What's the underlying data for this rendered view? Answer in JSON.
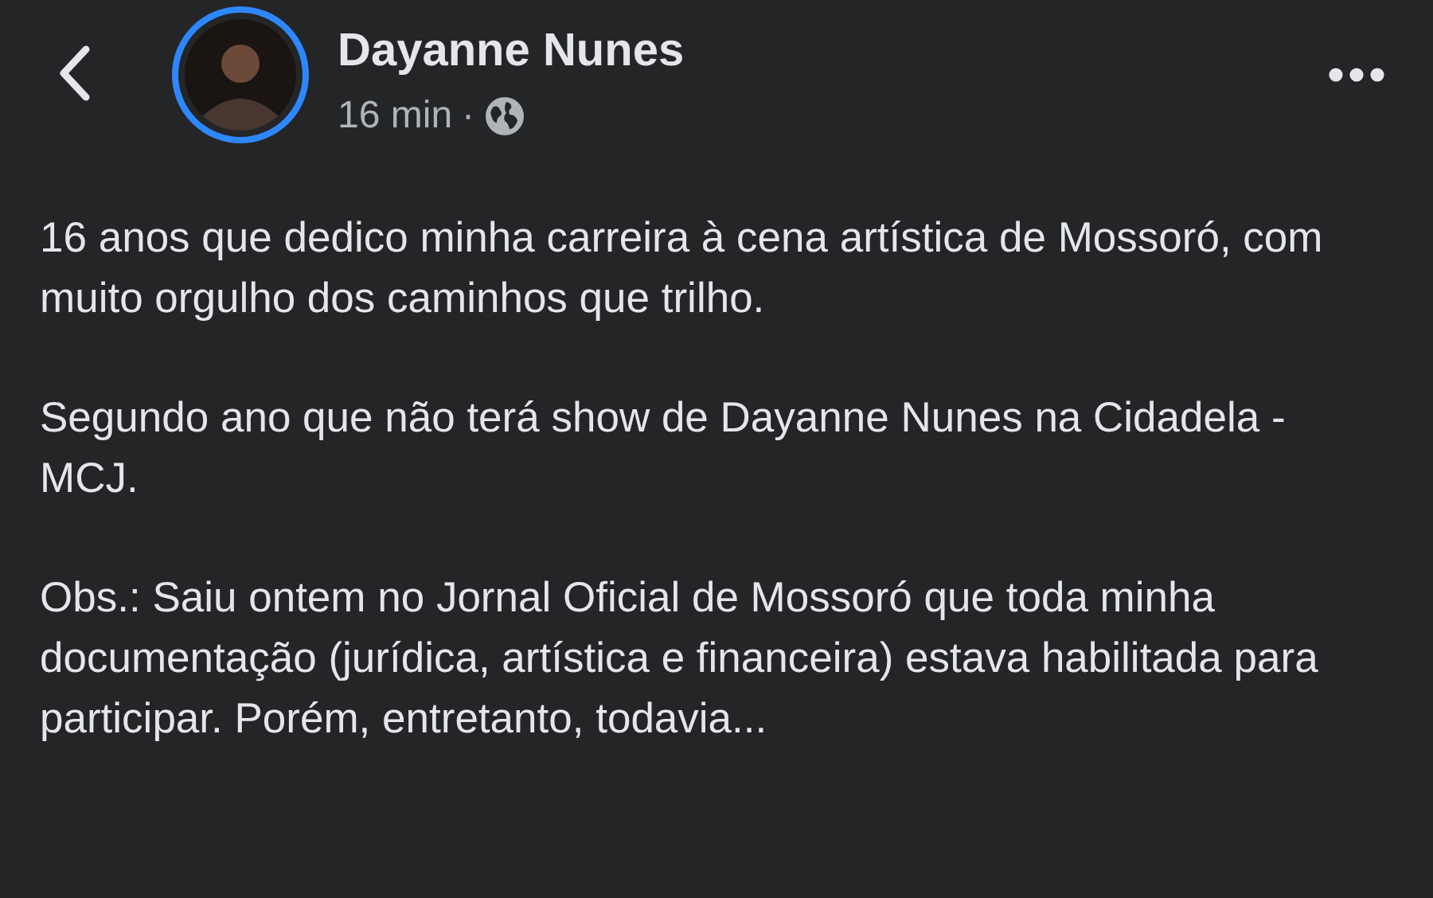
{
  "post": {
    "author": "Dayanne Nunes",
    "time": "16 min",
    "separator": "·",
    "paragraphs": [
      "16 anos que dedico minha carreira à cena artística de Mossoró, com muito orgulho dos caminhos que trilho.",
      "Segundo ano que não terá show de Dayanne Nunes na Cidadela - MCJ.",
      "Obs.: Saiu ontem no Jornal Oficial de Mossoró que toda minha documentação (jurídica, artística e financeira) estava habilitada para participar. Porém, entretanto, todavia..."
    ]
  }
}
